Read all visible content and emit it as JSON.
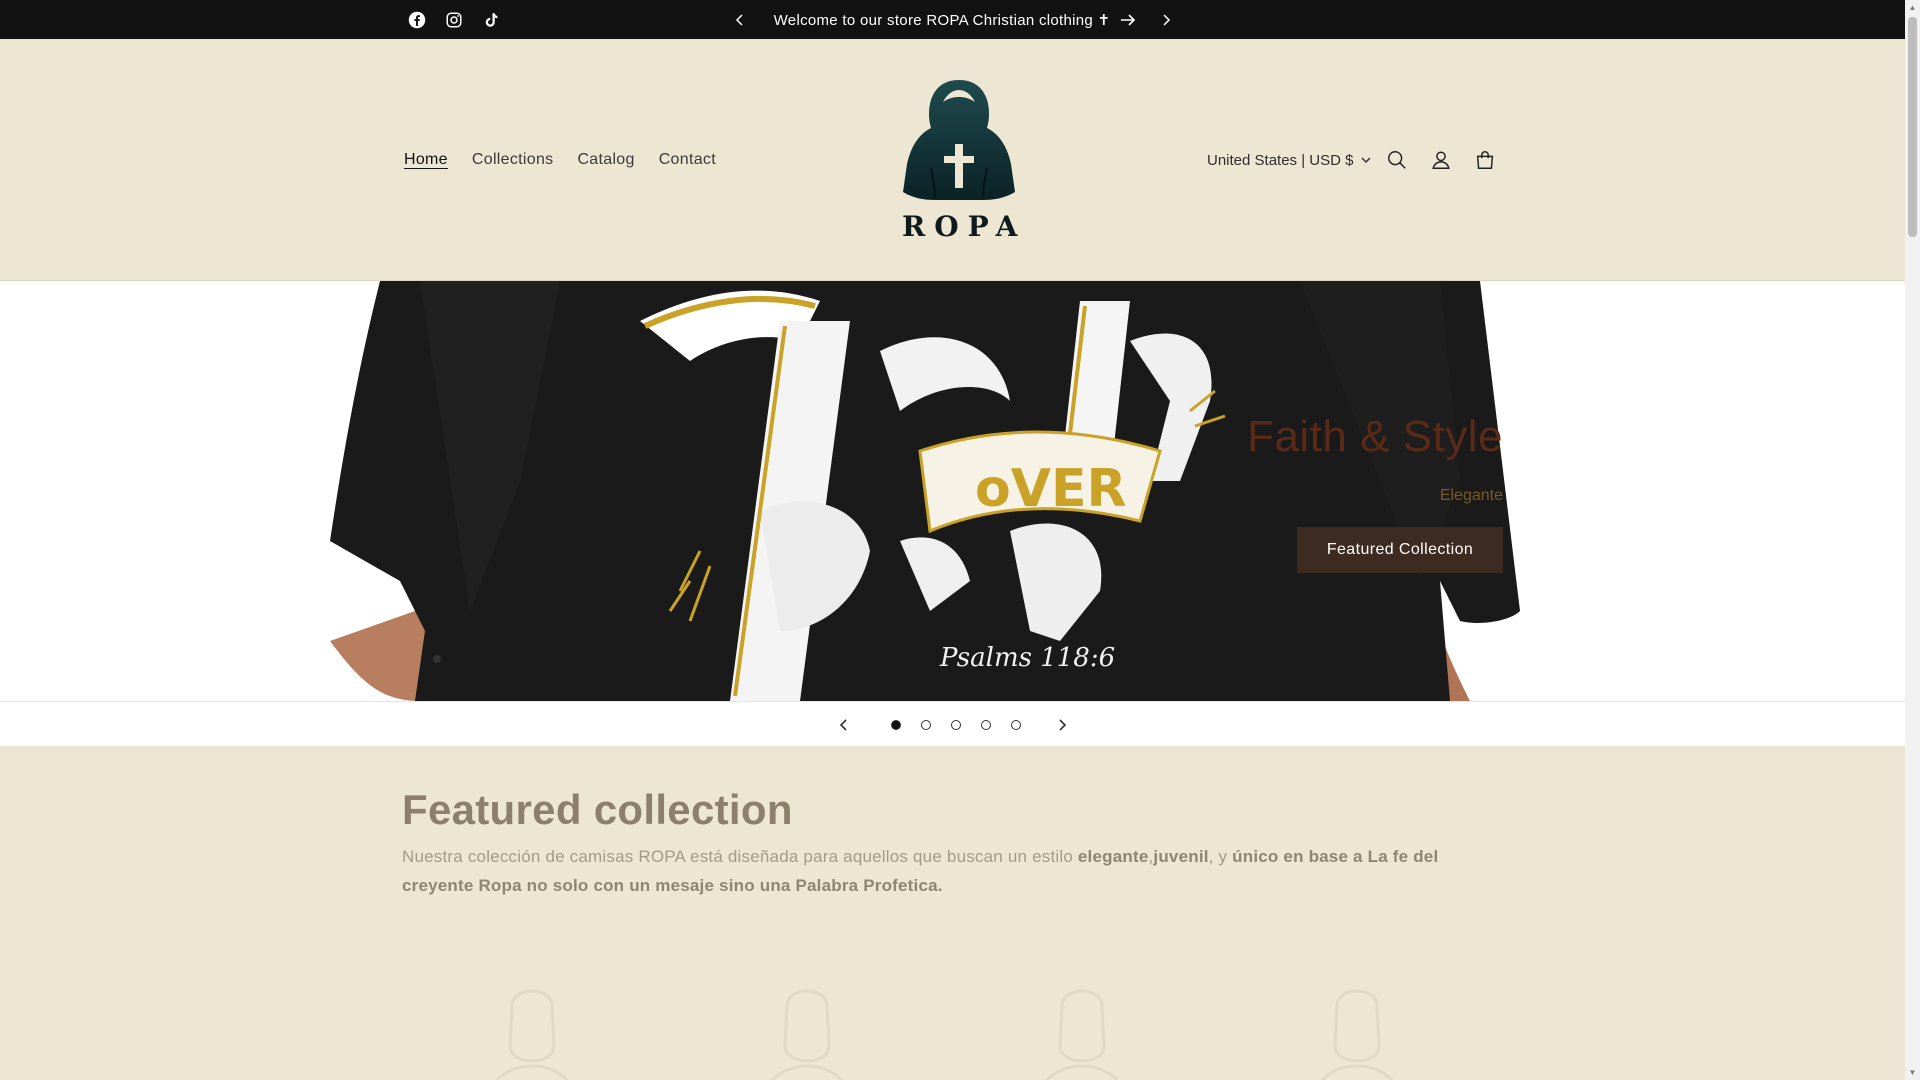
{
  "announcement": {
    "text": "Welcome to our store ROPA Christian clothing ✝",
    "socials": [
      "facebook-icon",
      "instagram-icon",
      "tiktok-icon"
    ]
  },
  "header": {
    "nav": [
      {
        "label": "Home",
        "active": true
      },
      {
        "label": "Collections",
        "active": false
      },
      {
        "label": "Catalog",
        "active": false
      },
      {
        "label": "Contact",
        "active": false
      }
    ],
    "logo_text": "ROPA",
    "country": "United States | USD $",
    "icons": [
      "search-icon",
      "account-icon",
      "cart-icon"
    ]
  },
  "hero": {
    "title": "Faith & Style",
    "subtitle": "Elegante",
    "button": "Featured Collection",
    "slide_count": 5,
    "active_slide": 1
  },
  "featured": {
    "title": "Featured collection",
    "desc_part1": "Nuestra colección de camisas ROPA está diseñada para aquellos que buscan un estilo ",
    "desc_bold1": "elegante",
    "desc_part2": ",",
    "desc_bold2": "juvenil",
    "desc_part3": ", y ",
    "desc_bold3": "único en base a La fe del creyente Ropa no solo con un mesaje sino una Palabra Profetica."
  },
  "colors": {
    "background": "#ede6d3",
    "topbar": "#121212",
    "button": "#3d2a20",
    "hero_title": "#5a2a18"
  }
}
